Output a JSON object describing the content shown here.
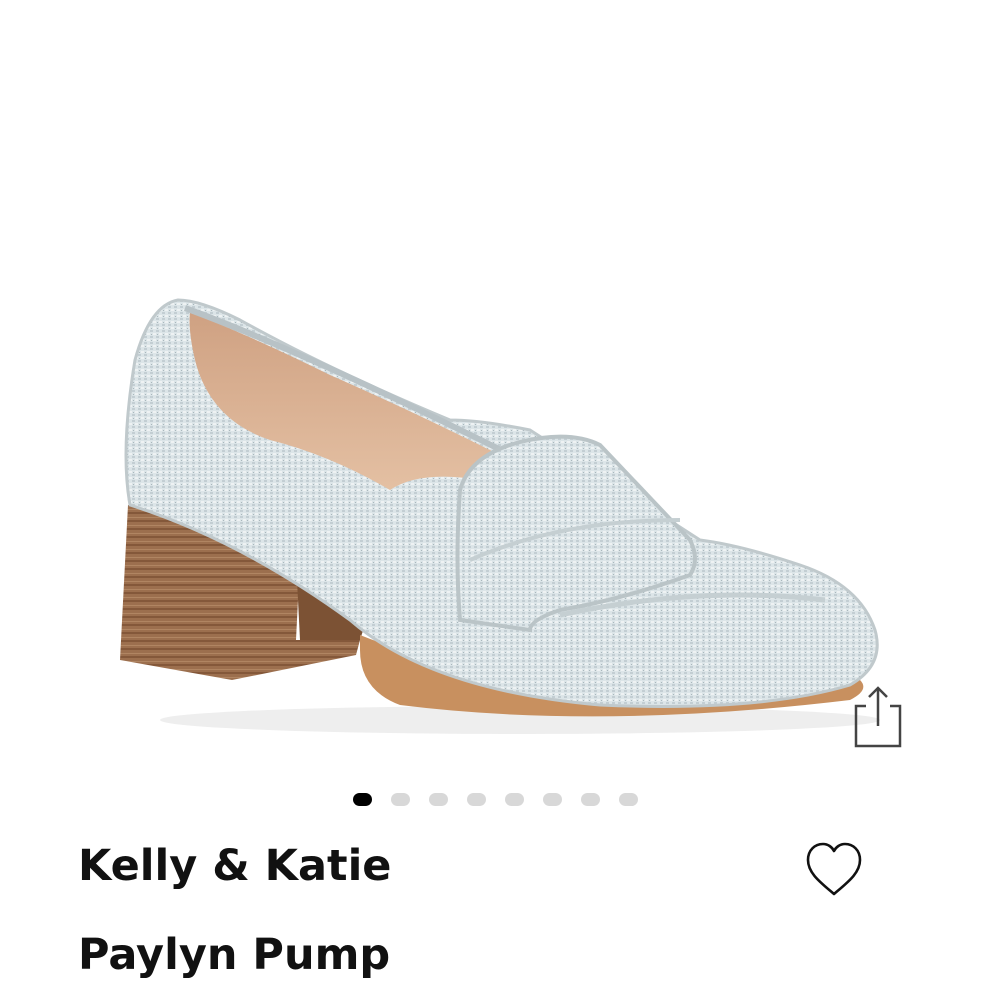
{
  "product": {
    "brand": "Kelly & Katie",
    "name": "Paylyn Pump",
    "image_alt_icon": "shoe-image"
  },
  "gallery": {
    "dot_count": 8,
    "active_index": 0
  },
  "actions": {
    "share_icon": "share-icon",
    "wishlist_icon": "heart-icon"
  },
  "colors": {
    "dot_active": "#000000",
    "dot_inactive": "#d8d8d8"
  }
}
